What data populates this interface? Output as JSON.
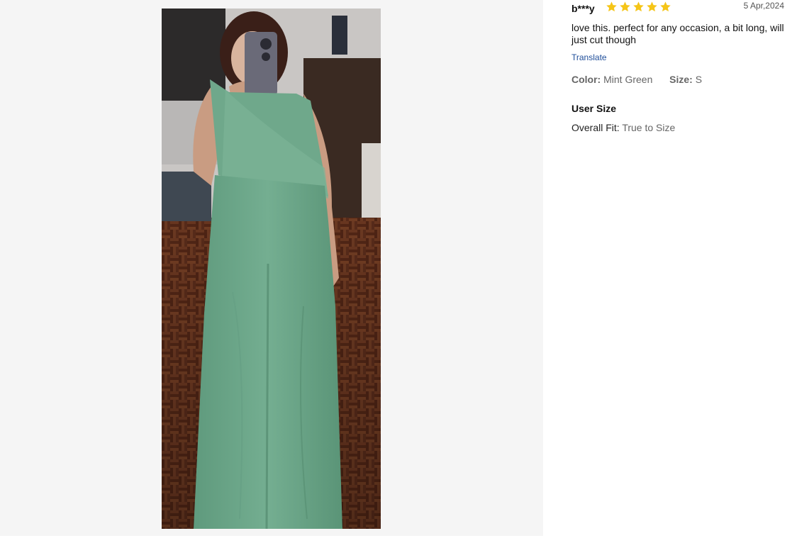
{
  "review": {
    "reviewer": "b***y",
    "rating": 5,
    "date": "5 Apr,2024",
    "text": "love this. perfect for any occasion, a bit long, will just cut though",
    "translate_label": "Translate",
    "color_label": "Color:",
    "color_value": "Mint Green",
    "size_label": "Size:",
    "size_value": "S",
    "user_size_title": "User Size",
    "overall_fit_label": "Overall Fit:",
    "overall_fit_value": "True to Size"
  },
  "colors": {
    "star": "#f5c518",
    "link": "#1f4e9a",
    "dress": "#6fa88b",
    "floor": "#6b3520"
  },
  "icons": [
    "star-icon"
  ]
}
